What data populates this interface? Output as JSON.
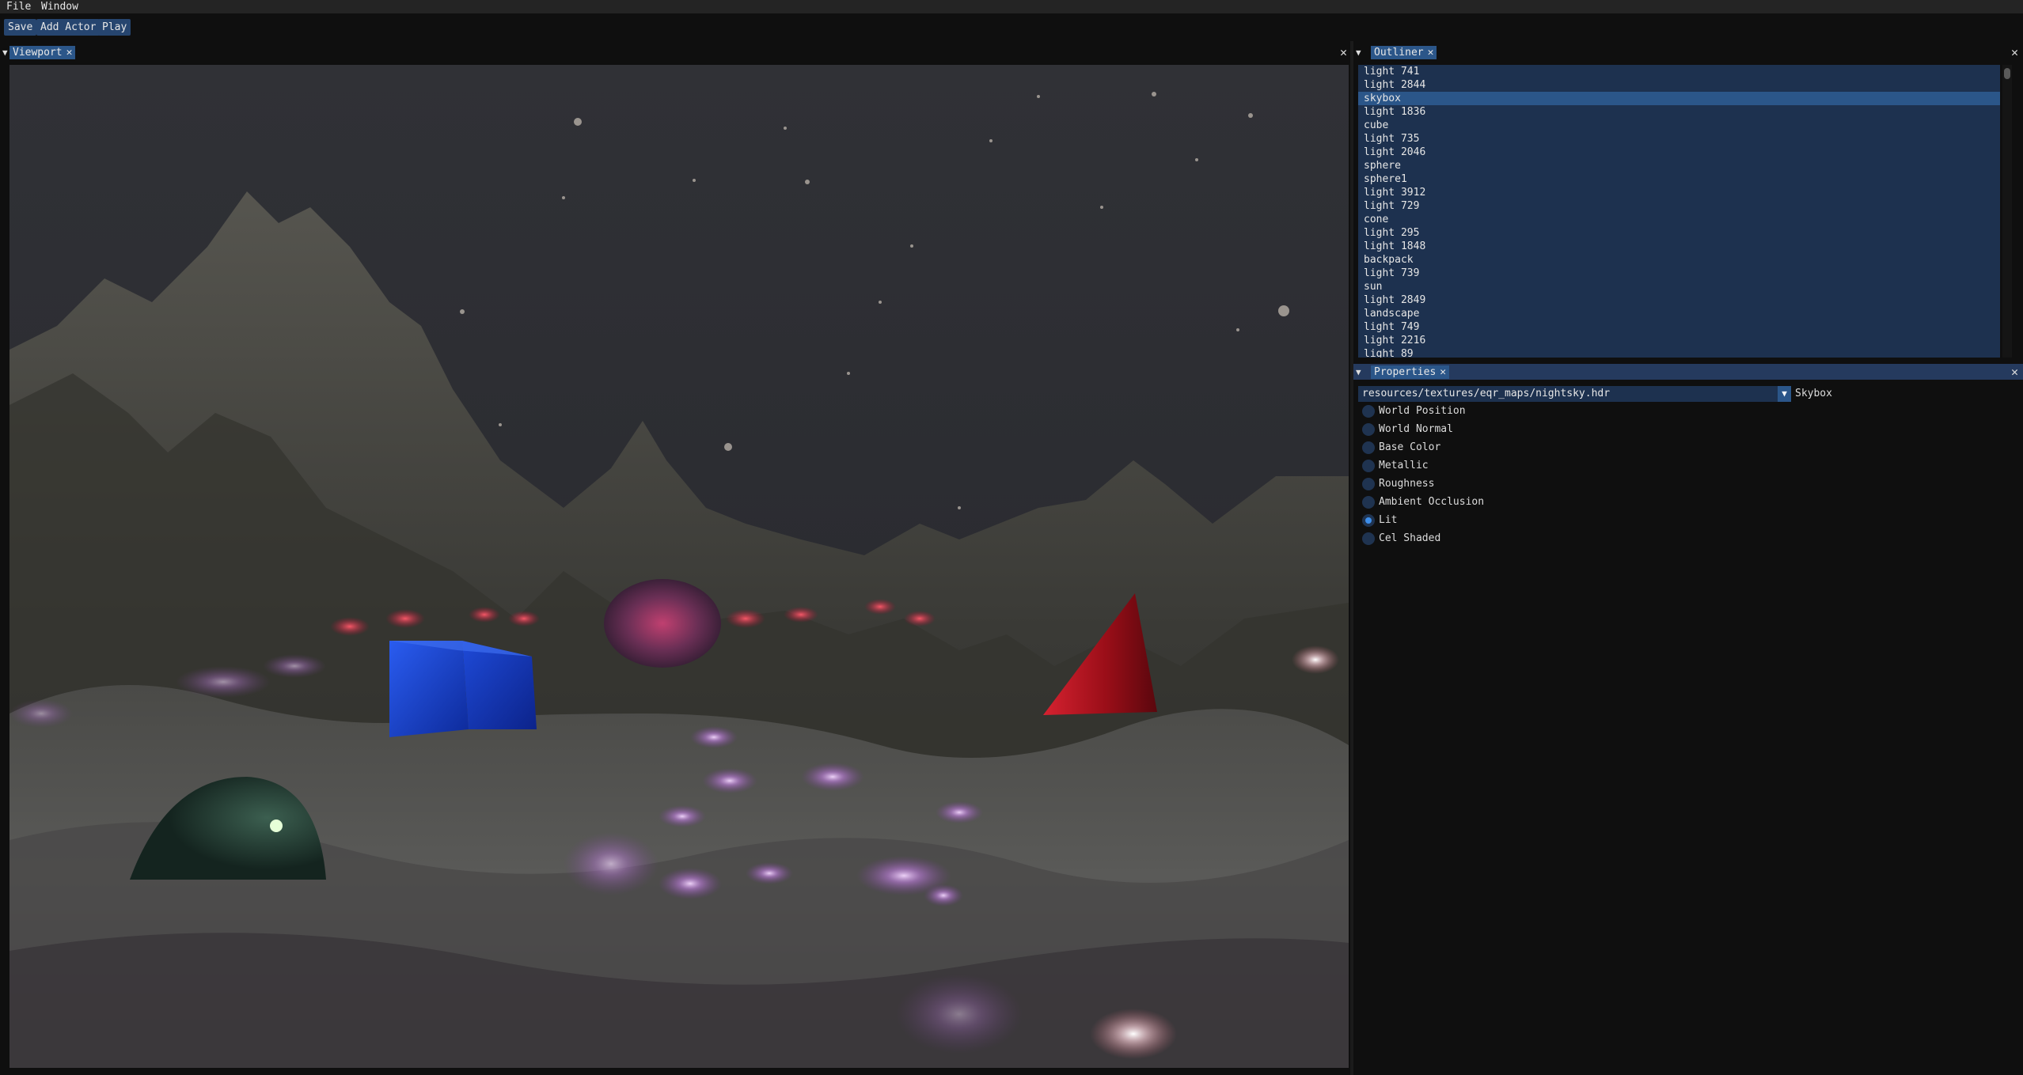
{
  "menubar": {
    "file": "File",
    "window": "Window"
  },
  "toolbar": {
    "save": "Save",
    "add_actor": "Add Actor",
    "play": "Play"
  },
  "viewport_panel": {
    "tab": "Viewport",
    "tab_close": "✕",
    "close": "✕"
  },
  "outliner_panel": {
    "tab": "Outliner",
    "tab_close": "✕",
    "close": "✕",
    "items": [
      "light 741",
      "light 2844",
      "skybox",
      "light 1836",
      "cube",
      "light 735",
      "light 2046",
      "sphere",
      "sphere1",
      "light 3912",
      "light 729",
      "cone",
      "light 295",
      "light 1848",
      "backpack",
      "light 739",
      "sun",
      "light 2849",
      "landscape",
      "light 749",
      "light 2216",
      "light 89"
    ],
    "selected_index": 2
  },
  "properties_panel": {
    "tab": "Properties",
    "tab_close": "✕",
    "close": "✕",
    "texture_path": "resources/textures/eqr_maps/nightsky.hdr",
    "combo_label": "Skybox",
    "render_modes": [
      "World Position",
      "World Normal",
      "Base Color",
      "Metallic",
      "Roughness",
      "Ambient Occlusion",
      "Lit",
      "Cel Shaded"
    ],
    "selected_mode_index": 6
  },
  "colors": {
    "accent": "#2b5689",
    "panel_active": "#253a5e",
    "list_bg": "#1d314f",
    "radio_on": "#3d8eea"
  }
}
